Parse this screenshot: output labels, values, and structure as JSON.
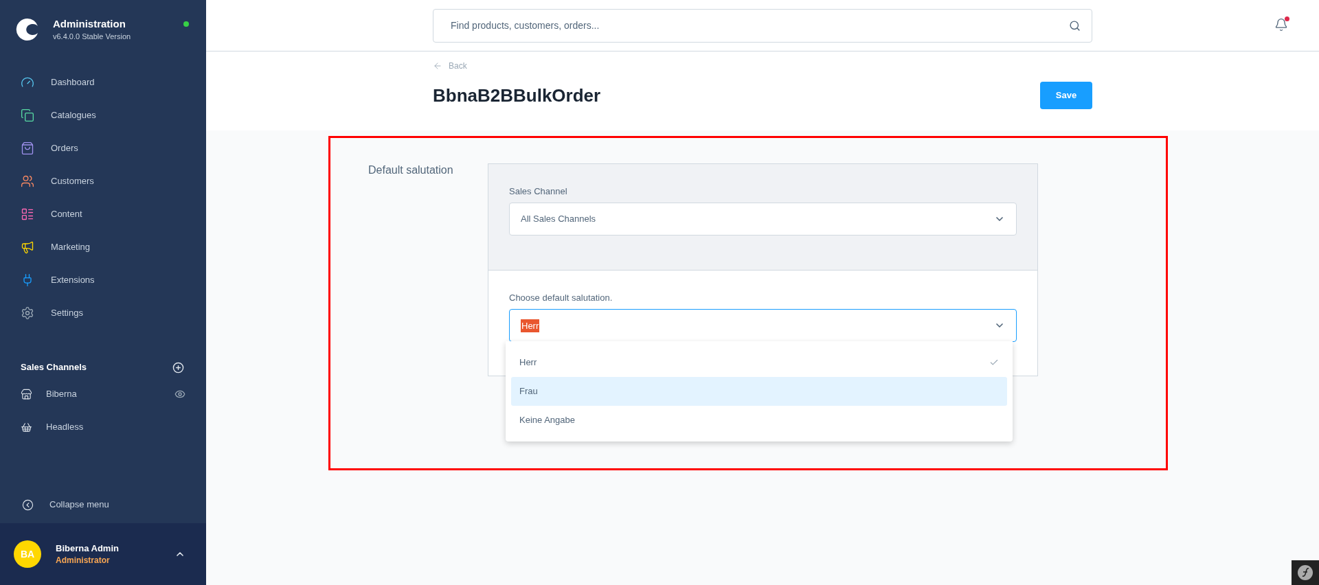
{
  "sidebar": {
    "app_title": "Administration",
    "version": "v6.4.0.0 Stable Version",
    "online": true,
    "items": [
      {
        "kind": "dashboard",
        "label": "Dashboard",
        "color": "#57c6ee"
      },
      {
        "kind": "catalogues",
        "label": "Catalogues",
        "color": "#57d9a3"
      },
      {
        "kind": "orders",
        "label": "Orders",
        "color": "#a092f0"
      },
      {
        "kind": "customers",
        "label": "Customers",
        "color": "#f88962"
      },
      {
        "kind": "content",
        "label": "Content",
        "color": "#ff68b4"
      },
      {
        "kind": "marketing",
        "label": "Marketing",
        "color": "#ffd700"
      },
      {
        "kind": "extensions",
        "label": "Extensions",
        "color": "#189eff"
      },
      {
        "kind": "settings",
        "label": "Settings",
        "color": "#9aa8b5"
      }
    ],
    "sales_channels": {
      "title": "Sales Channels",
      "items": [
        {
          "kind": "storefront",
          "label": "Biberna",
          "preview": true
        },
        {
          "kind": "headless",
          "label": "Headless",
          "preview": false
        }
      ]
    },
    "collapse": "Collapse menu",
    "user": {
      "initials": "BA",
      "name": "Biberna Admin",
      "role": "Administrator"
    }
  },
  "header": {
    "search": {
      "placeholder": "Find products, customers, orders..."
    },
    "notification": true
  },
  "page": {
    "back": "Back",
    "title": "BbnaB2BBulkOrder",
    "save": "Save"
  },
  "form": {
    "label": "Default salutation",
    "sales_channel": {
      "label": "Sales Channel",
      "value": "All Sales Channels"
    },
    "salutation": {
      "label": "Choose default salutation.",
      "value": "Herr",
      "expanded": true,
      "options": [
        {
          "label": "Herr",
          "selected": true,
          "highlighted": false
        },
        {
          "label": "Frau",
          "selected": false,
          "highlighted": true
        },
        {
          "label": "Keine Angabe",
          "selected": false,
          "highlighted": false
        }
      ]
    }
  }
}
